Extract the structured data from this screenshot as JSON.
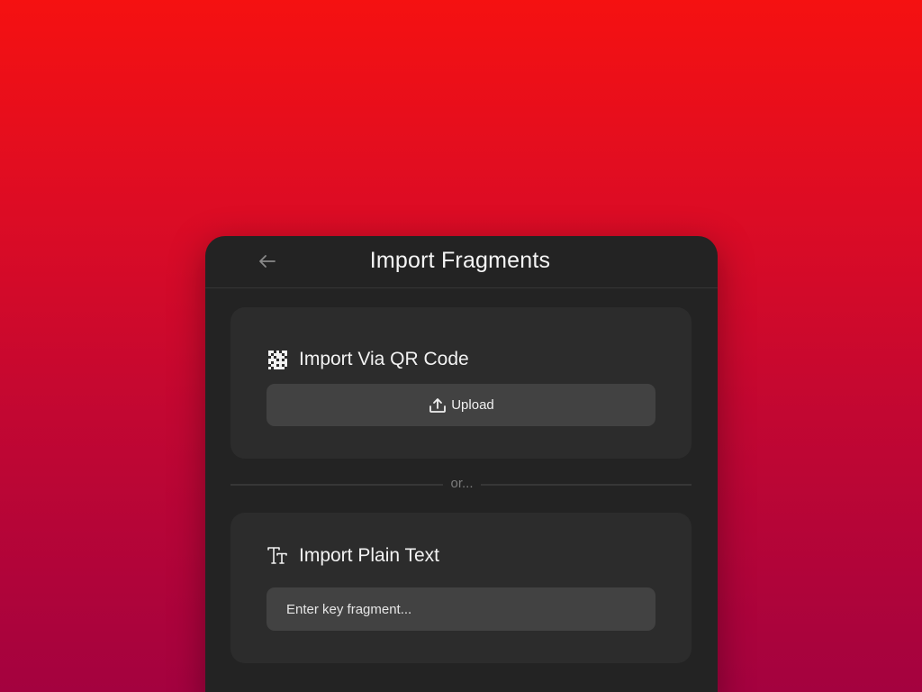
{
  "dialog": {
    "title": "Import Fragments",
    "back_icon": "arrow-left-icon"
  },
  "qr_section": {
    "heading": "Import Via QR Code",
    "icon": "qr-code-icon",
    "upload_label": "Upload",
    "upload_icon": "upload-icon"
  },
  "divider": {
    "label": "or..."
  },
  "text_section": {
    "heading": "Import Plain Text",
    "icon": "text-type-icon",
    "input_placeholder": "Enter key fragment...",
    "input_value": ""
  },
  "colors": {
    "background_top": "#f51111",
    "background_bottom": "#a4023f",
    "panel": "#232323",
    "card": "#2c2c2c",
    "control": "#424242"
  }
}
